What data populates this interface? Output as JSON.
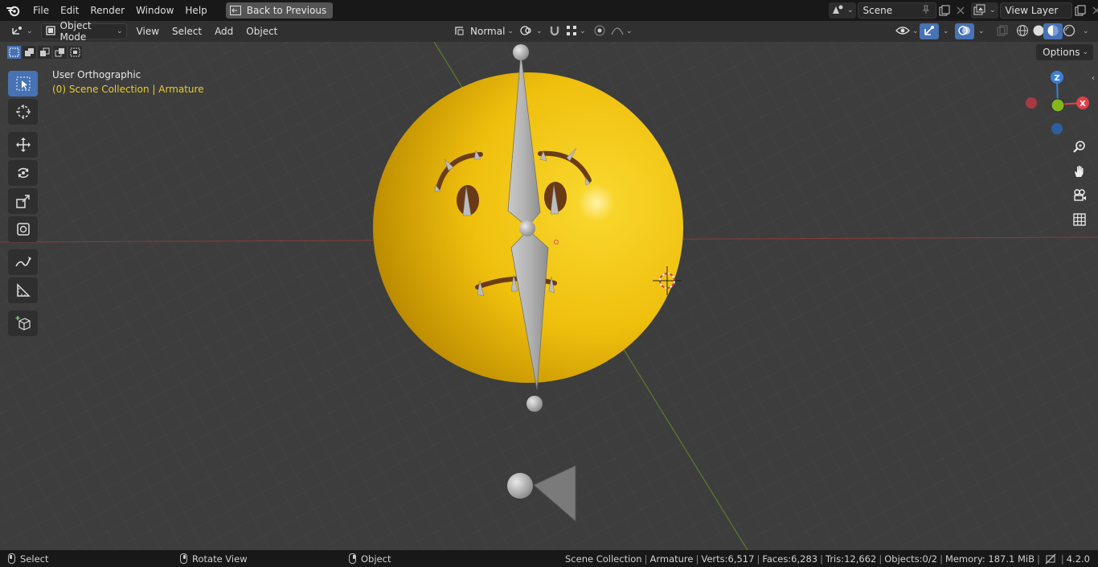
{
  "menubar": {
    "items": [
      "File",
      "Edit",
      "Render",
      "Window",
      "Help"
    ],
    "back_button": "Back to Previous",
    "scene_name": "Scene",
    "view_layer_name": "View Layer"
  },
  "header": {
    "mode": "Object Mode",
    "menus": [
      "View",
      "Select",
      "Add",
      "Object"
    ],
    "orientation": "Normal",
    "options_label": "Options"
  },
  "viewport": {
    "view_name": "User Orthographic",
    "collection_info": "(0) Scene Collection | Armature",
    "gizmo_axes": {
      "z": "Z",
      "x": "X"
    }
  },
  "statusbar": {
    "hint_select": "Select",
    "hint_rotate": "Rotate View",
    "hint_object": "Object",
    "collection": "Scene Collection",
    "active": "Armature",
    "verts": "Verts:6,517",
    "faces": "Faces:6,283",
    "tris": "Tris:12,662",
    "objects": "Objects:0/2",
    "memory": "Memory: 187.1 MiB",
    "version": "4.2.0"
  },
  "colors": {
    "accent": "#4772b3",
    "collection_text": "#e9cb30",
    "viewport_bg": "#3d3d3d",
    "emoji_yellow": "#f0c419",
    "axis_x": "#e0414a",
    "axis_y": "#85b61d",
    "axis_z": "#3c7fd8"
  }
}
